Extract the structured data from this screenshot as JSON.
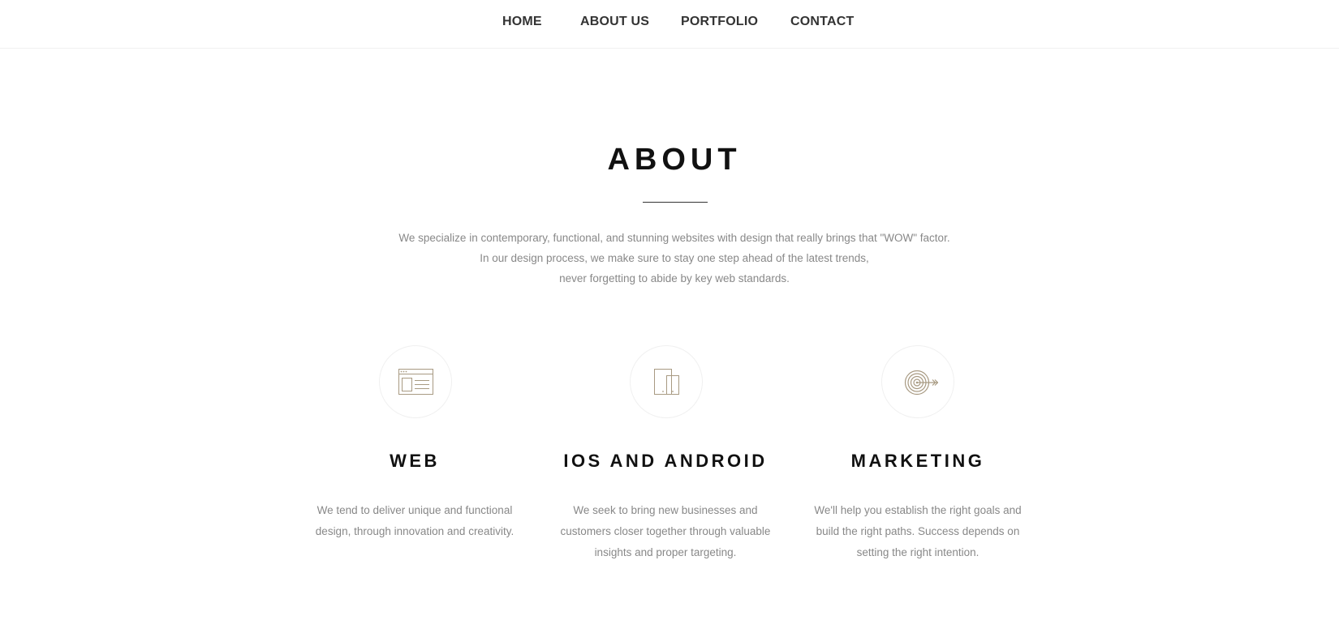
{
  "nav": {
    "items": [
      {
        "label": "HOME"
      },
      {
        "label": "ABOUT US"
      },
      {
        "label": "PORTFOLIO"
      },
      {
        "label": "CONTACT"
      }
    ]
  },
  "about": {
    "title": "ABOUT",
    "intro": [
      "We specialize in contemporary, functional, and stunning websites with design that really brings that \"WOW\" factor.",
      "In our design process, we make sure to stay one step ahead of the latest trends,",
      "never forgetting to abide by key web standards."
    ]
  },
  "services": [
    {
      "icon": "browser-window-icon",
      "title": "WEB",
      "lines": [
        "We tend to deliver unique and functional",
        "design, through innovation and creativity."
      ]
    },
    {
      "icon": "mobile-devices-icon",
      "title": "IOS AND ANDROID",
      "lines": [
        "We seek to bring new businesses and",
        "customers closer together through valuable",
        "insights and proper targeting."
      ]
    },
    {
      "icon": "target-arrow-icon",
      "title": "MARKETING",
      "lines": [
        "We'll help you establish the right goals and",
        "build the right paths. Success depends on",
        "setting the right intention."
      ]
    }
  ],
  "colors": {
    "accent_icon": "#a89a82",
    "heading": "#111111",
    "body_text": "#888888",
    "nav_text": "#333333"
  }
}
